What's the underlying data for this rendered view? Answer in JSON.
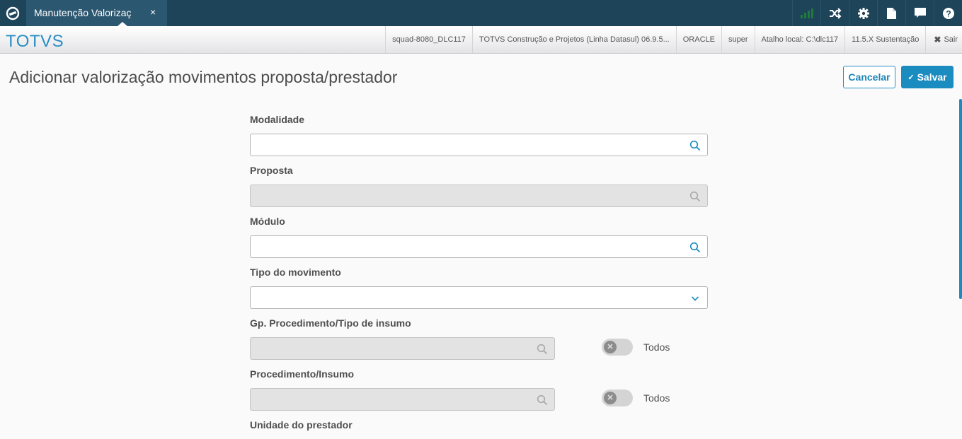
{
  "topbar": {
    "tab_label": "Manutenção Valorizaç",
    "tab_close": "×",
    "icons": [
      "signal-icon",
      "shuffle-icon",
      "gear-icon",
      "document-icon",
      "chat-icon",
      "help-icon"
    ]
  },
  "subheader": {
    "brand": "TOTVS",
    "info": [
      "squad-8080_DLC117",
      "TOTVS Construção e Projetos (Linha Datasul) 06.9.5...",
      "ORACLE",
      "super",
      "Atalho local: C:\\dlc117",
      "11.5.X Sustentação"
    ],
    "exit_label": "Sair"
  },
  "page": {
    "title": "Adicionar valorização movimentos proposta/prestador",
    "cancel_label": "Cancelar",
    "save_label": "Salvar"
  },
  "form": {
    "modalidade_label": "Modalidade",
    "modalidade_value": "",
    "proposta_label": "Proposta",
    "proposta_value": "",
    "modulo_label": "Módulo",
    "modulo_value": "",
    "tipo_movimento_label": "Tipo do movimento",
    "tipo_movimento_value": "",
    "gp_procedimento_label": "Gp. Procedimento/Tipo de insumo",
    "gp_procedimento_value": "",
    "gp_todos_label": "Todos",
    "procedimento_label": "Procedimento/Insumo",
    "procedimento_value": "",
    "proc_todos_label": "Todos",
    "unidade_label": "Unidade do prestador"
  },
  "colors": {
    "topbar": "#1d4459",
    "tab": "#2b5770",
    "accent": "#1b8cc0",
    "brand": "#2a8ec4"
  }
}
